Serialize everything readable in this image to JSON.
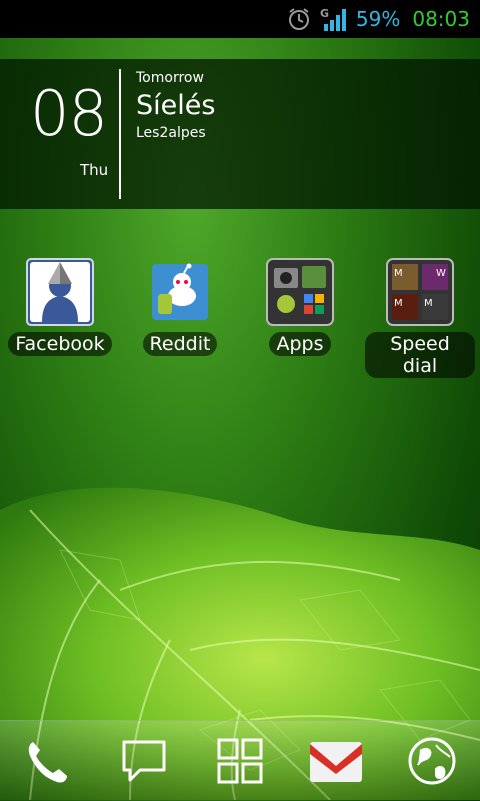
{
  "status_bar": {
    "network_type": "G",
    "battery_percent": "59%",
    "time": "08:03",
    "icons": [
      "alarm-icon",
      "signal-icon"
    ]
  },
  "widget": {
    "hour": "08",
    "day": "Thu",
    "label": "Tomorrow",
    "city": "Síelés",
    "subtitle": "Les2alpes"
  },
  "apps": [
    {
      "label": "Facebook",
      "icon": "facebook-icon"
    },
    {
      "label": "Reddit",
      "icon": "reddit-icon"
    },
    {
      "label": "Apps",
      "icon": "apps-folder-icon"
    },
    {
      "label": "Speed dial",
      "icon": "speed-dial-icon"
    }
  ],
  "dock": [
    "phone-icon",
    "messaging-icon",
    "app-drawer-icon",
    "gmail-icon",
    "browser-icon"
  ]
}
